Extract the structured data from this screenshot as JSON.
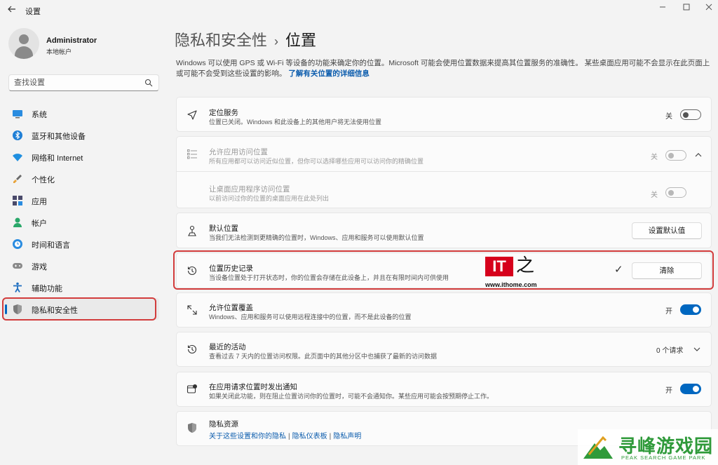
{
  "window": {
    "title": "设置"
  },
  "user": {
    "name": "Administrator",
    "type": "本地帐户"
  },
  "search": {
    "placeholder": "查找设置"
  },
  "sidebar": {
    "items": [
      {
        "label": "系统",
        "icon": "monitor-icon"
      },
      {
        "label": "蓝牙和其他设备",
        "icon": "bluetooth-icon"
      },
      {
        "label": "网络和 Internet",
        "icon": "wifi-icon"
      },
      {
        "label": "个性化",
        "icon": "brush-icon"
      },
      {
        "label": "应用",
        "icon": "apps-icon"
      },
      {
        "label": "帐户",
        "icon": "person-icon"
      },
      {
        "label": "时间和语言",
        "icon": "globe-clock-icon"
      },
      {
        "label": "游戏",
        "icon": "gamepad-icon"
      },
      {
        "label": "辅助功能",
        "icon": "accessibility-icon"
      },
      {
        "label": "隐私和安全性",
        "icon": "shield-icon",
        "active": true
      }
    ]
  },
  "header": {
    "parent": "隐私和安全性",
    "separator": "›",
    "current": "位置"
  },
  "description": {
    "text": "Windows 可以使用 GPS 或 Wi-Fi 等设备的功能来确定你的位置。Microsoft 可能会使用位置数据来提高其位置服务的准确性。 某些桌面应用可能不会显示在此页面上或可能不会受到这些设置的影响。",
    "link": "了解有关位置的详细信息"
  },
  "settings": {
    "location_service": {
      "title": "定位服务",
      "subtitle": "位置已关闭。Windows 和此设备上的其他用户将无法使用位置",
      "state_label": "关",
      "on": false
    },
    "app_access": {
      "title": "允许应用访问位置",
      "subtitle": "所有应用都可以访问近似位置，但你可以选择哪些应用可以访问你的精确位置",
      "state_label": "关",
      "on": false
    },
    "desktop_access": {
      "title": "让桌面应用程序访问位置",
      "subtitle": "以前访问过你的位置的桌面应用在此处列出",
      "state_label": "关",
      "on": false
    },
    "default_location": {
      "title": "默认位置",
      "subtitle": "当我们无法检测到更精确的位置时，Windows、应用和服务可以使用默认位置",
      "button": "设置默认值"
    },
    "history": {
      "title": "位置历史记录",
      "subtitle": "当设备位置处于打开状态时，你的位置会存储在此设备上，并且在有限时间内可供使用",
      "check": "✓",
      "button": "清除"
    },
    "override": {
      "title": "允许位置覆盖",
      "subtitle": "Windows、应用和服务可以使用远程连接中的位置，而不是此设备的位置",
      "state_label": "开",
      "on": true
    },
    "recent_activity": {
      "title": "最近的活动",
      "subtitle": "查看过去 7 天内的位置访问权限。此页面中的其他分区中也捕获了最新的访问数据",
      "value": "0 个请求"
    },
    "notify": {
      "title": "在应用请求位置时发出通知",
      "subtitle": "如果关闭此功能，则在阻止位置访问你的位置时，可能不会通知你。某些应用可能会按预期停止工作。",
      "state_label": "开",
      "on": true
    },
    "privacy_resources": {
      "title": "隐私资源",
      "links": [
        "关于这些设置和你的隐私",
        "隐私仪表板",
        "隐私声明"
      ],
      "separator": "|"
    }
  },
  "watermarks": {
    "ithome_logo": "IT之家",
    "ithome_url": "www.ithome.com",
    "site_name": "寻峰游戏园",
    "site_sub": "PEAK SEARCH GAME PARK"
  },
  "colors": {
    "accent": "#0067c0",
    "highlight_box": "#d23c3c",
    "link": "#0b5cad"
  }
}
